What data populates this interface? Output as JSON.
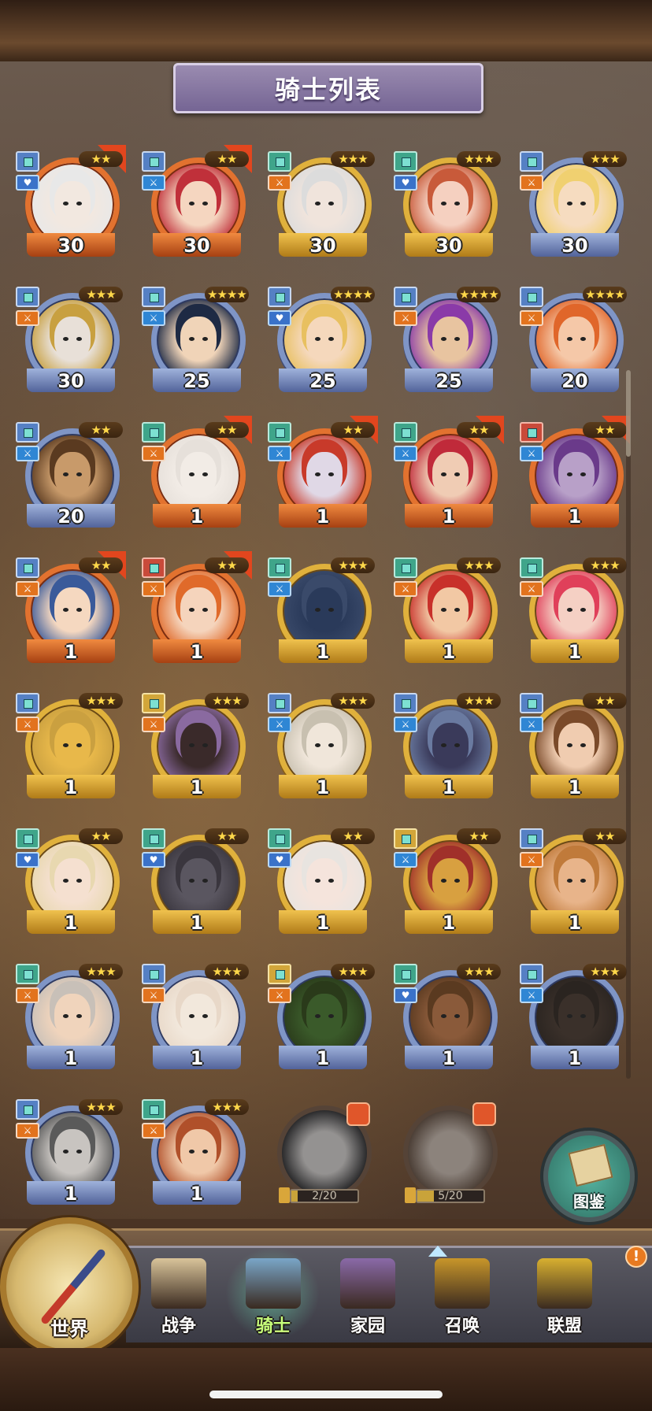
{
  "screen": {
    "title": "骑士列表"
  },
  "knights": [
    {
      "level": "30",
      "frame": "red",
      "stars": "★★",
      "arrow": true,
      "cls": "blue",
      "role": "heart",
      "skin": "#f2e8e0",
      "hair": "#e8e8e8"
    },
    {
      "level": "30",
      "frame": "red",
      "stars": "★★",
      "arrow": true,
      "cls": "blue",
      "role": "blue",
      "skin": "#f5d6c0",
      "hair": "#c0303a"
    },
    {
      "level": "30",
      "frame": "gold",
      "stars": "★★★",
      "arrow": false,
      "cls": "green",
      "role": "orange",
      "skin": "#f0e4dc",
      "hair": "#dcdcdc"
    },
    {
      "level": "30",
      "frame": "gold",
      "stars": "★★★",
      "arrow": false,
      "cls": "green",
      "role": "heart",
      "skin": "#f5d0c0",
      "hair": "#c85a3a"
    },
    {
      "level": "30",
      "frame": "blue",
      "stars": "★★★",
      "arrow": false,
      "cls": "blue",
      "role": "orange",
      "skin": "#f6dcc0",
      "hair": "#f0d070"
    },
    {
      "level": "30",
      "frame": "blue",
      "stars": "★★★",
      "arrow": false,
      "cls": "blue",
      "role": "orange",
      "skin": "#e8e0d8",
      "hair": "#c8a040"
    },
    {
      "level": "25",
      "frame": "blue",
      "stars": "★★★★",
      "arrow": false,
      "cls": "blue",
      "role": "blue",
      "skin": "#f0d4b8",
      "hair": "#1e2a44"
    },
    {
      "level": "25",
      "frame": "blue",
      "stars": "★★★★",
      "arrow": false,
      "cls": "blue",
      "role": "heart",
      "skin": "#f5d8bc",
      "hair": "#e8c060"
    },
    {
      "level": "25",
      "frame": "blue",
      "stars": "★★★★",
      "arrow": false,
      "cls": "blue",
      "role": "orange",
      "skin": "#e8c4a0",
      "hair": "#8a3aa8"
    },
    {
      "level": "20",
      "frame": "blue",
      "stars": "★★★★",
      "arrow": false,
      "cls": "blue",
      "role": "orange",
      "skin": "#f5c8a8",
      "hair": "#e0662a"
    },
    {
      "level": "20",
      "frame": "blue",
      "stars": "★★",
      "arrow": false,
      "cls": "blue",
      "role": "blue",
      "skin": "#c89a6a",
      "hair": "#5a3a20"
    },
    {
      "level": "1",
      "frame": "red",
      "stars": "★★",
      "arrow": true,
      "cls": "green",
      "role": "orange",
      "skin": "#f2ece6",
      "hair": "#e6e0da"
    },
    {
      "level": "1",
      "frame": "red",
      "stars": "★★",
      "arrow": true,
      "cls": "green",
      "role": "blue",
      "skin": "#e0d8e6",
      "hair": "#c83a2a"
    },
    {
      "level": "1",
      "frame": "red",
      "stars": "★★",
      "arrow": true,
      "cls": "green",
      "role": "blue",
      "skin": "#f0ccb4",
      "hair": "#c02a3a"
    },
    {
      "level": "1",
      "frame": "red",
      "stars": "★★",
      "arrow": true,
      "cls": "red",
      "role": "blue",
      "skin": "#b8a0c8",
      "hair": "#6a3a8a"
    },
    {
      "level": "1",
      "frame": "red",
      "stars": "★★",
      "arrow": true,
      "cls": "blue",
      "role": "orange",
      "skin": "#f5d8c0",
      "hair": "#3a5a9a"
    },
    {
      "level": "1",
      "frame": "red",
      "stars": "★★",
      "arrow": true,
      "cls": "red",
      "role": "orange",
      "skin": "#f5d4bc",
      "hair": "#e06a2a"
    },
    {
      "level": "1",
      "frame": "gold",
      "stars": "★★★",
      "arrow": false,
      "cls": "green",
      "role": "blue",
      "skin": "#2a3a5a",
      "hair": "#3a4a6a"
    },
    {
      "level": "1",
      "frame": "gold",
      "stars": "★★★",
      "arrow": false,
      "cls": "green",
      "role": "orange",
      "skin": "#f2c8a4",
      "hair": "#c8302a"
    },
    {
      "level": "1",
      "frame": "gold",
      "stars": "★★★",
      "arrow": false,
      "cls": "green",
      "role": "orange",
      "skin": "#f5d0c4",
      "hair": "#e0405a"
    },
    {
      "level": "1",
      "frame": "gold",
      "stars": "★★★",
      "arrow": false,
      "cls": "blue",
      "role": "orange",
      "skin": "#e8b84a",
      "hair": "#caa040"
    },
    {
      "level": "1",
      "frame": "gold",
      "stars": "★★★",
      "arrow": false,
      "cls": "yellow",
      "role": "orange",
      "skin": "#3a2a2a",
      "hair": "#8a6aa0"
    },
    {
      "level": "1",
      "frame": "gold",
      "stars": "★★★",
      "arrow": false,
      "cls": "blue",
      "role": "blue",
      "skin": "#f0e6da",
      "hair": "#c8c0b0"
    },
    {
      "level": "1",
      "frame": "gold",
      "stars": "★★★",
      "arrow": false,
      "cls": "blue",
      "role": "blue",
      "skin": "#3a3a5a",
      "hair": "#6a7aa0"
    },
    {
      "level": "1",
      "frame": "gold",
      "stars": "★★",
      "arrow": false,
      "cls": "blue",
      "role": "blue",
      "skin": "#f0ccb0",
      "hair": "#7a4a2a"
    },
    {
      "level": "1",
      "frame": "gold",
      "stars": "★★",
      "arrow": false,
      "cls": "green",
      "role": "heart",
      "skin": "#f5e0d0",
      "hair": "#e8d8b0"
    },
    {
      "level": "1",
      "frame": "gold",
      "stars": "★★",
      "arrow": false,
      "cls": "green",
      "role": "heart",
      "skin": "#5a5660",
      "hair": "#3a363e"
    },
    {
      "level": "1",
      "frame": "gold",
      "stars": "★★",
      "arrow": false,
      "cls": "green",
      "role": "heart",
      "skin": "#f5e4dc",
      "hair": "#e8e4e0"
    },
    {
      "level": "1",
      "frame": "gold",
      "stars": "★★",
      "arrow": false,
      "cls": "yellow",
      "role": "blue",
      "skin": "#d8a040",
      "hair": "#a0302a"
    },
    {
      "level": "1",
      "frame": "gold",
      "stars": "★★",
      "arrow": false,
      "cls": "blue",
      "role": "orange",
      "skin": "#e8b48a",
      "hair": "#c07a3a"
    },
    {
      "level": "1",
      "frame": "blue",
      "stars": "★★★",
      "arrow": false,
      "cls": "green",
      "role": "orange",
      "skin": "#f0d4bc",
      "hair": "#c8c0b8"
    },
    {
      "level": "1",
      "frame": "blue",
      "stars": "★★★",
      "arrow": false,
      "cls": "blue",
      "role": "orange",
      "skin": "#f2e8dc",
      "hair": "#e8d8c8"
    },
    {
      "level": "1",
      "frame": "blue",
      "stars": "★★★",
      "arrow": false,
      "cls": "yellow",
      "role": "orange",
      "skin": "#3a5a2a",
      "hair": "#2a3a1a"
    },
    {
      "level": "1",
      "frame": "blue",
      "stars": "★★★",
      "arrow": false,
      "cls": "green",
      "role": "heart",
      "skin": "#8a5a3a",
      "hair": "#5a3a20"
    },
    {
      "level": "1",
      "frame": "blue",
      "stars": "★★★",
      "arrow": false,
      "cls": "blue",
      "role": "blue",
      "skin": "#3a302a",
      "hair": "#2a2420"
    },
    {
      "level": "1",
      "frame": "blue",
      "stars": "★★★",
      "arrow": false,
      "cls": "blue",
      "role": "orange",
      "skin": "#c8c4c0",
      "hair": "#5a5a5a"
    },
    {
      "level": "1",
      "frame": "blue",
      "stars": "★★★",
      "arrow": false,
      "cls": "green",
      "role": "orange",
      "skin": "#f0c8a8",
      "hair": "#b0502a"
    }
  ],
  "locked_knights": [
    {
      "shards": "2/20",
      "fill": 0.1,
      "skin": "#d8d0cc",
      "hair": "#2a2a30"
    },
    {
      "shards": "5/20",
      "fill": 0.25,
      "skin": "#d8b8a0",
      "hair": "#7a4a2a"
    }
  ],
  "codex": {
    "label": "图鉴"
  },
  "compass": {
    "label": "世界"
  },
  "nav": [
    {
      "label": "战争",
      "art": "#d9c49a",
      "active": false
    },
    {
      "label": "骑士",
      "art": "#7aa6c8",
      "active": true
    },
    {
      "label": "家园",
      "art": "#8a6aa8",
      "active": false
    },
    {
      "label": "召唤",
      "art": "#c8962a",
      "active": false
    },
    {
      "label": "联盟",
      "art": "#d8b030",
      "active": false
    }
  ],
  "alert": {
    "text": "!"
  }
}
